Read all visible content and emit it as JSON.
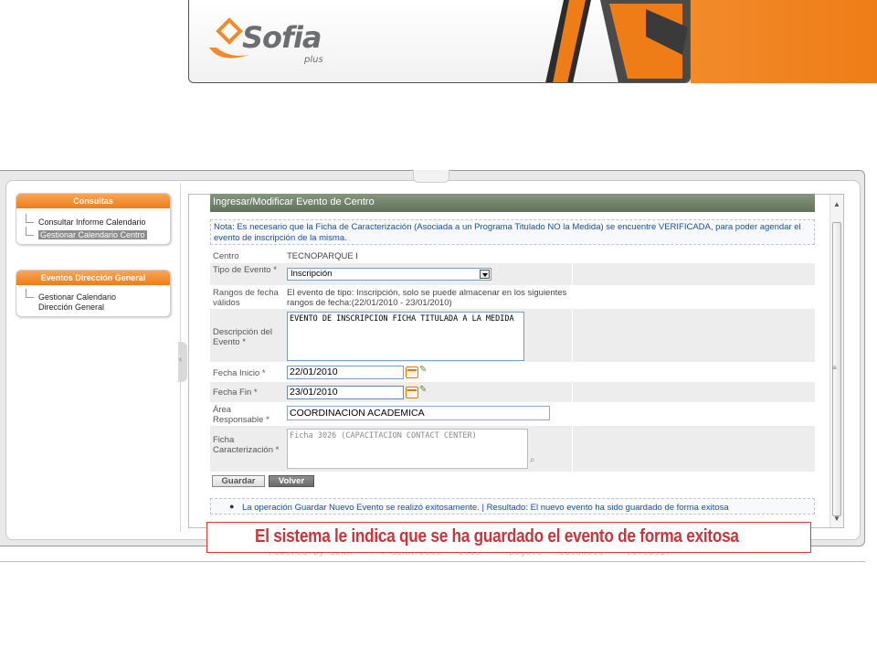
{
  "colors": {
    "brand_orange": "#ef7d17",
    "title_bar": "#6b7e65",
    "note_text": "#1a4f9a",
    "callout_red": "#c9353a"
  },
  "header": {
    "logo": "Sofia",
    "logo_sub": "plus"
  },
  "sidebar": {
    "panels": [
      {
        "title": "Consultas",
        "items": [
          "Consultar Informe Calendario",
          "Gestionar Calendario Centro"
        ]
      },
      {
        "title": "Eventos Dirección General",
        "items": [
          "Gestionar Calendario Dirección General"
        ]
      }
    ]
  },
  "form": {
    "title": "Ingresar/Modificar Evento de Centro",
    "note": "Nota: Es necesario que la Ficha de Caracterización (Asociada a un Programa Titulado NO la Medida) se encuentre VERIFICADA, para poder agendar el evento de inscripción de la misma.",
    "centro_label": "Centro",
    "centro_value": "TECNOPARQUE I",
    "tipo_label": "Tipo de Evento *",
    "tipo_value": "Inscripción",
    "rangos_label": "Rangos de fecha válidos",
    "rangos_value": "El evento de tipo: Inscripción, solo se puede almacenar en los siguientes rangos de fecha:(22/01/2010 - 23/01/2010)",
    "descripcion_label": "Descripción del Evento *",
    "descripcion_value": "EVENTO DE INSCRIPCION FICHA TITULADA A LA MEDIDA",
    "fecha_inicio_label": "Fecha Inicio *",
    "fecha_inicio_value": "22/01/2010",
    "fecha_fin_label": "Fecha Fin *",
    "fecha_fin_value": "23/01/2010",
    "area_label": "Área Responsable *",
    "area_value": "COORDINACION ACADEMICA",
    "ficha_label": "Ficha Caracterización *",
    "ficha_value": "Ficha 3026 (CAPACITACION CONTACT CENTER)",
    "guardar": "Guardar",
    "volver": "Volver"
  },
  "message": "La operación Guardar Nuevo Evento se realizó exitosamente. | Resultado: El nuevo evento ha sido guardado de forma exitosa",
  "footer": "• Powered by SENA --- © SENA 2006 - 2009 --- Bogotá - Colombia- --carlos1.",
  "callout": "El sistema le indica que se ha guardado el evento de forma exitosa"
}
